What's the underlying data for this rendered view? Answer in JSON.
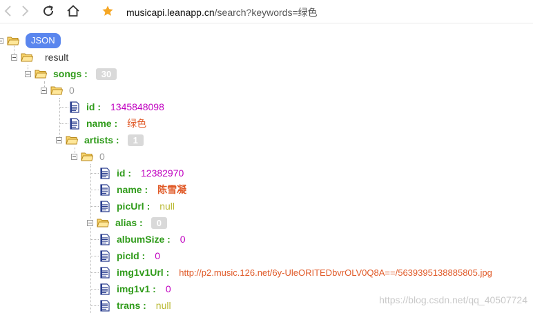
{
  "browser": {
    "url_host": "musicapi.leanapp.cn",
    "url_path": "/search?keywords=绿色",
    "icons": [
      "back-icon",
      "forward-icon",
      "reload-icon",
      "home-icon",
      "star-icon"
    ]
  },
  "tree": {
    "root_label": "JSON",
    "result_key": "result",
    "songs_key": "songs :",
    "songs_count": "30",
    "song_index": "0",
    "id_key": "id :",
    "id_value": "1345848098",
    "name_key": "name :",
    "name_value": "绿色",
    "artists_key": "artists :",
    "artists_count": "1",
    "artist_index": "0",
    "artist": {
      "id_key": "id :",
      "id_value": "12382970",
      "name_key": "name :",
      "name_value": "陈雪凝",
      "picUrl_key": "picUrl :",
      "picUrl_value": "null",
      "alias_key": "alias :",
      "alias_count": "0",
      "albumSize_key": "albumSize :",
      "albumSize_value": "0",
      "picId_key": "picId :",
      "picId_value": "0",
      "img1v1Url_key": "img1v1Url :",
      "img1v1Url_value": "http://p2.music.126.net/6y-UleORITEDbvrOLV0Q8A==/5639395138885805.jpg",
      "img1v1_key": "img1v1 :",
      "img1v1_value": "0",
      "trans_key": "trans :",
      "trans_value": "null"
    }
  },
  "watermark": "https://blog.csdn.net/qq_40507724",
  "colors": {
    "key": "#2f9b1a",
    "number": "#c000c0",
    "string": "#e05a28",
    "null": "#b8b830",
    "root_pill": "#5a86ee",
    "star": "#f5a623"
  }
}
